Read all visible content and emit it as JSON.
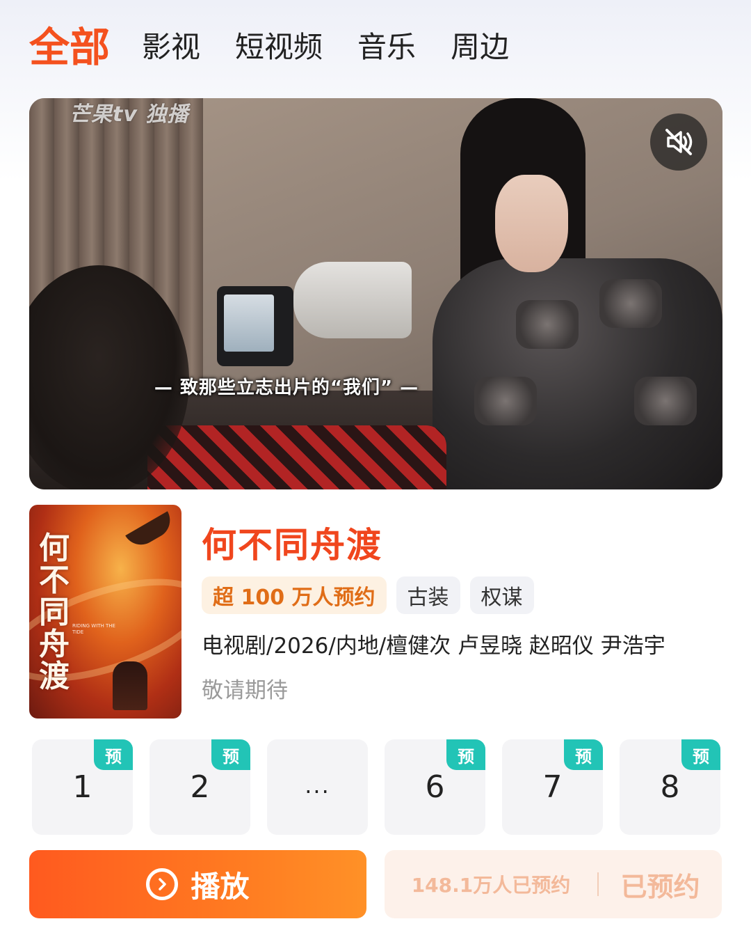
{
  "tabs": [
    {
      "label": "全部",
      "active": true
    },
    {
      "label": "影视"
    },
    {
      "label": "短视频"
    },
    {
      "label": "音乐"
    },
    {
      "label": "周边"
    }
  ],
  "video": {
    "watermark": "芒果tv 独播",
    "subtitle": "— 致那些立志出片的“我们” —",
    "mute_icon": "volume-muted-icon"
  },
  "show": {
    "poster_title": "何不同舟渡",
    "poster_subtitle": "RIDING WITH THE TIDE",
    "title": "何不同舟渡",
    "tags": [
      {
        "label": "超 100 万人预约",
        "type": "hot"
      },
      {
        "label": "古装",
        "type": "normal"
      },
      {
        "label": "权谋",
        "type": "normal"
      }
    ],
    "meta": "电视剧/2026/内地/檀健次 卢昱晓 赵昭仪 尹浩宇",
    "status": "敬请期待"
  },
  "episodes": [
    {
      "label": "1",
      "badge": "预"
    },
    {
      "label": "2",
      "badge": "预"
    },
    {
      "label": "...",
      "badge": ""
    },
    {
      "label": "6",
      "badge": "预"
    },
    {
      "label": "7",
      "badge": "预"
    },
    {
      "label": "8",
      "badge": "预"
    }
  ],
  "actions": {
    "play_label": "播放",
    "reserve_count": "148.1万人已预约",
    "reserve_label": "已预约"
  },
  "colors": {
    "accent": "#f4511e",
    "badge": "#22c4b6",
    "hot_tag_text": "#e06d17"
  }
}
